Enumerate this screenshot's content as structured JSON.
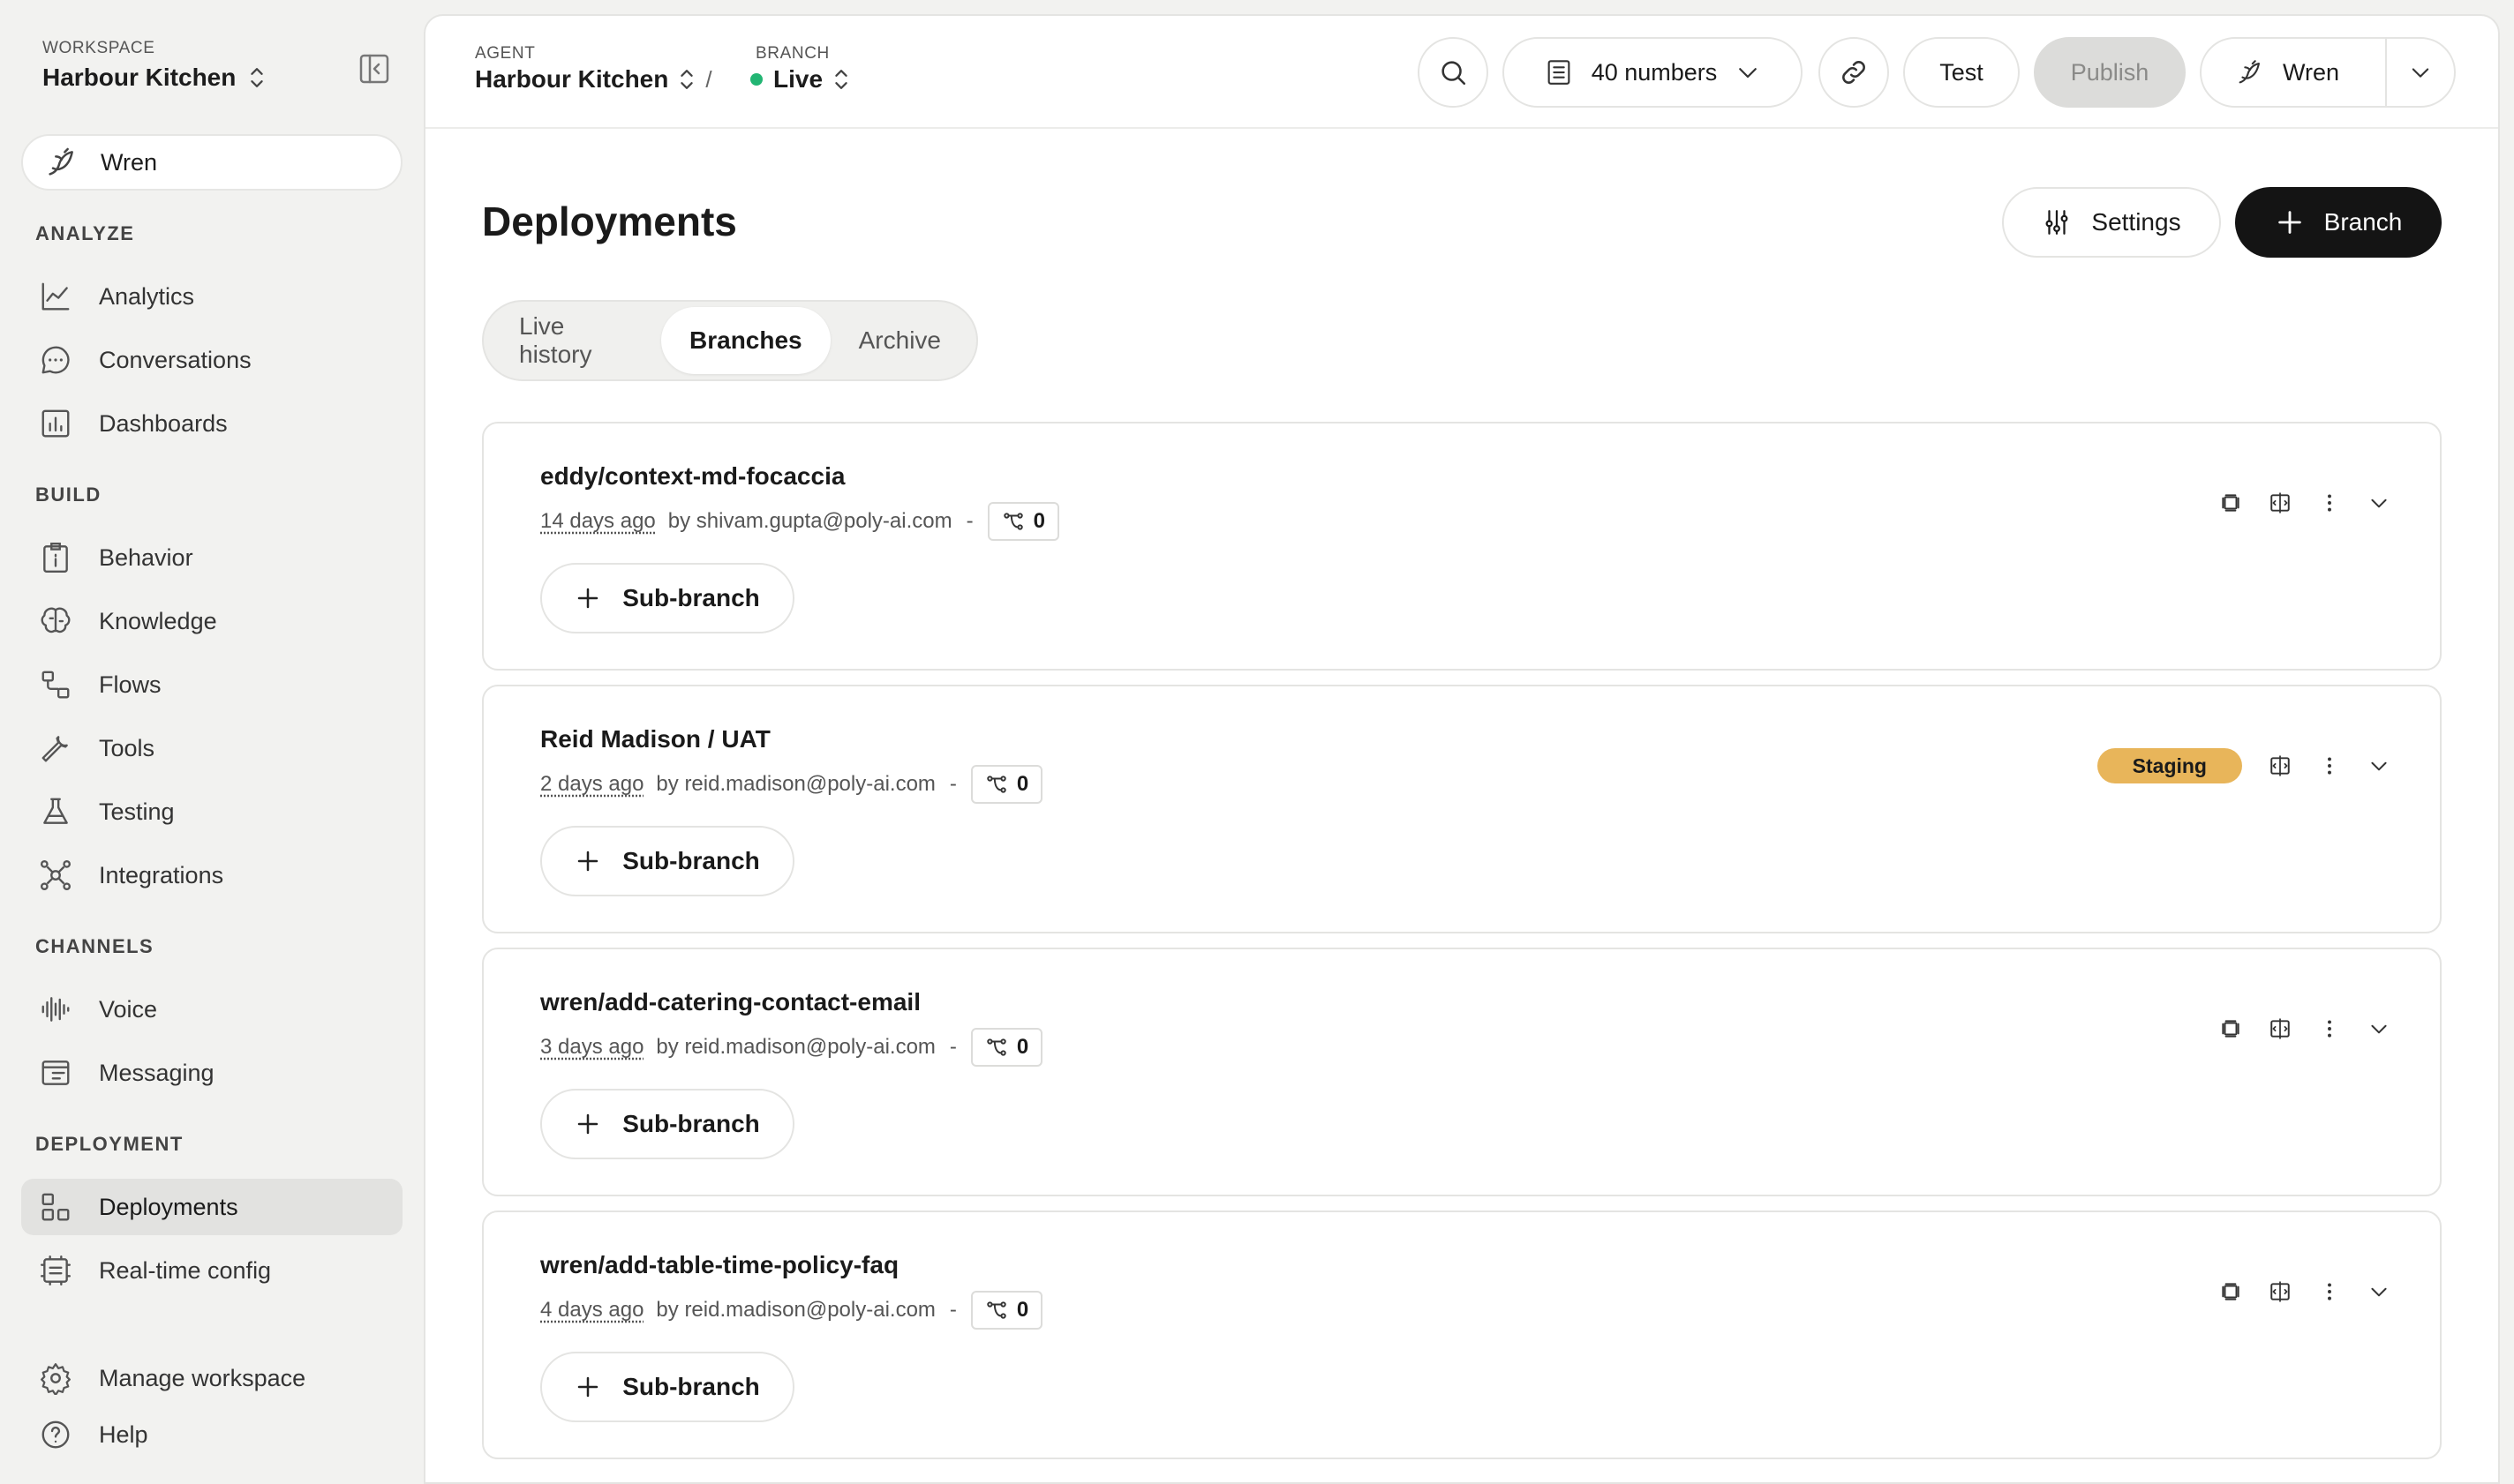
{
  "workspace": {
    "label": "WORKSPACE",
    "name": "Harbour Kitchen"
  },
  "sidebar": {
    "agent_pill": "Wren",
    "sections": {
      "analyze": "ANALYZE",
      "build": "BUILD",
      "channels": "CHANNELS",
      "deployment": "DEPLOYMENT"
    },
    "items": {
      "analytics": "Analytics",
      "conversations": "Conversations",
      "dashboards": "Dashboards",
      "behavior": "Behavior",
      "knowledge": "Knowledge",
      "flows": "Flows",
      "tools": "Tools",
      "testing": "Testing",
      "integrations": "Integrations",
      "voice": "Voice",
      "messaging": "Messaging",
      "deployments": "Deployments",
      "realtime": "Real-time config",
      "manage": "Manage workspace",
      "help": "Help"
    },
    "active_item": "Deployments"
  },
  "topbar": {
    "agent_label": "AGENT",
    "agent_name": "Harbour Kitchen",
    "separator": "/",
    "branch_label": "BRANCH",
    "branch_name": "Live",
    "numbers_label": "40 numbers",
    "test_label": "Test",
    "publish_label": "Publish",
    "user_label": "Wren"
  },
  "page": {
    "title": "Deployments",
    "settings_label": "Settings",
    "branch_label": "Branch",
    "tabs": [
      "Live history",
      "Branches",
      "Archive"
    ],
    "active_tab": "Branches",
    "sub_branch_label": "Sub-branch"
  },
  "branches": [
    {
      "name": "eddy/context-md-focaccia",
      "ago": "14 days ago",
      "author": "by shivam.gupta@poly-ai.com",
      "sep": "-",
      "sub_count": "0"
    },
    {
      "name": "Reid Madison / UAT",
      "ago": "2 days ago",
      "author": "by reid.madison@poly-ai.com",
      "sep": "-",
      "sub_count": "0",
      "badge": "Staging"
    },
    {
      "name": "wren/add-catering-contact-email",
      "ago": "3 days ago",
      "author": "by reid.madison@poly-ai.com",
      "sep": "-",
      "sub_count": "0"
    },
    {
      "name": "wren/add-table-time-policy-faq",
      "ago": "4 days ago",
      "author": "by reid.madison@poly-ai.com",
      "sep": "-",
      "sub_count": "0"
    }
  ],
  "colors": {
    "live": "#22b573",
    "staging": "#e8b55a",
    "primary": "#141414"
  }
}
